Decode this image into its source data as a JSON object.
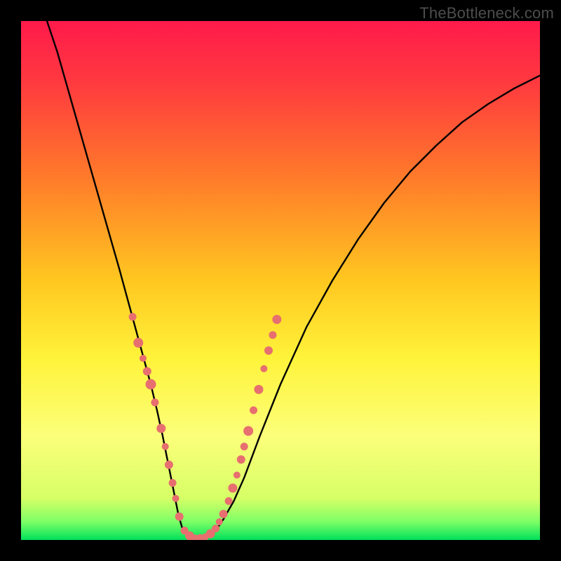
{
  "watermark": "TheBottleneck.com",
  "chart_data": {
    "type": "line",
    "title": "",
    "xlabel": "",
    "ylabel": "",
    "xlim": [
      0,
      100
    ],
    "ylim": [
      0,
      100
    ],
    "background_gradient": {
      "stops": [
        {
          "offset": 0.0,
          "color": "#ff1a4b"
        },
        {
          "offset": 0.12,
          "color": "#ff3a3f"
        },
        {
          "offset": 0.3,
          "color": "#ff7a2a"
        },
        {
          "offset": 0.5,
          "color": "#ffc720"
        },
        {
          "offset": 0.65,
          "color": "#fff33a"
        },
        {
          "offset": 0.8,
          "color": "#fcff7a"
        },
        {
          "offset": 0.92,
          "color": "#d6ff66"
        },
        {
          "offset": 0.965,
          "color": "#7dff66"
        },
        {
          "offset": 1.0,
          "color": "#00e05a"
        }
      ]
    },
    "series": [
      {
        "name": "bottleneck-curve",
        "color": "#000000",
        "width": 2.4,
        "x": [
          5,
          7,
          9,
          11,
          13,
          15,
          17,
          19,
          20.5,
          22,
          23.5,
          25,
          26.2,
          27.3,
          28.2,
          29,
          29.7,
          30.3,
          31,
          32,
          33.2,
          34.5,
          36,
          37.5,
          39,
          41,
          43,
          46,
          50,
          55,
          60,
          65,
          70,
          75,
          80,
          85,
          90,
          95,
          100
        ],
        "y": [
          100,
          94,
          87,
          80,
          73,
          66,
          59,
          52,
          46.5,
          41,
          35.5,
          30,
          25,
          20,
          15.5,
          11.5,
          8,
          5,
          2.5,
          1.0,
          0.4,
          0.2,
          0.6,
          1.8,
          4,
          7.5,
          12,
          20,
          30,
          41,
          50,
          58,
          65,
          71,
          76,
          80.5,
          84,
          87,
          89.5
        ]
      }
    ],
    "marker_series": [
      {
        "name": "sample-markers",
        "color": "#e76f6f",
        "radius_range": [
          4.0,
          8.0
        ],
        "points": [
          {
            "x": 21.5,
            "y": 43.0,
            "r": 5.5
          },
          {
            "x": 22.6,
            "y": 38.0,
            "r": 7.0
          },
          {
            "x": 23.5,
            "y": 35.0,
            "r": 5.0
          },
          {
            "x": 24.3,
            "y": 32.5,
            "r": 6.0
          },
          {
            "x": 25.0,
            "y": 30.0,
            "r": 7.5
          },
          {
            "x": 25.8,
            "y": 26.5,
            "r": 5.5
          },
          {
            "x": 27.0,
            "y": 21.5,
            "r": 6.5
          },
          {
            "x": 27.8,
            "y": 18.0,
            "r": 5.0
          },
          {
            "x": 28.5,
            "y": 14.5,
            "r": 6.0
          },
          {
            "x": 29.2,
            "y": 11.0,
            "r": 5.5
          },
          {
            "x": 29.8,
            "y": 8.0,
            "r": 5.0
          },
          {
            "x": 30.5,
            "y": 4.5,
            "r": 6.0
          },
          {
            "x": 31.5,
            "y": 1.8,
            "r": 5.5
          },
          {
            "x": 32.5,
            "y": 0.8,
            "r": 6.5
          },
          {
            "x": 33.5,
            "y": 0.3,
            "r": 5.5
          },
          {
            "x": 34.5,
            "y": 0.3,
            "r": 6.0
          },
          {
            "x": 35.5,
            "y": 0.6,
            "r": 5.0
          },
          {
            "x": 36.5,
            "y": 1.2,
            "r": 6.5
          },
          {
            "x": 37.5,
            "y": 2.2,
            "r": 5.5
          },
          {
            "x": 38.2,
            "y": 3.5,
            "r": 5.0
          },
          {
            "x": 39.0,
            "y": 5.0,
            "r": 6.0
          },
          {
            "x": 40.0,
            "y": 7.5,
            "r": 5.5
          },
          {
            "x": 40.8,
            "y": 10.0,
            "r": 6.5
          },
          {
            "x": 41.6,
            "y": 12.5,
            "r": 5.0
          },
          {
            "x": 42.4,
            "y": 15.5,
            "r": 6.0
          },
          {
            "x": 43.0,
            "y": 18.0,
            "r": 5.5
          },
          {
            "x": 43.8,
            "y": 21.0,
            "r": 7.0
          },
          {
            "x": 44.8,
            "y": 25.0,
            "r": 5.5
          },
          {
            "x": 45.8,
            "y": 29.0,
            "r": 6.5
          },
          {
            "x": 46.8,
            "y": 33.0,
            "r": 5.0
          },
          {
            "x": 47.7,
            "y": 36.5,
            "r": 6.0
          },
          {
            "x": 48.5,
            "y": 39.5,
            "r": 5.5
          },
          {
            "x": 49.3,
            "y": 42.5,
            "r": 6.5
          }
        ]
      }
    ]
  }
}
